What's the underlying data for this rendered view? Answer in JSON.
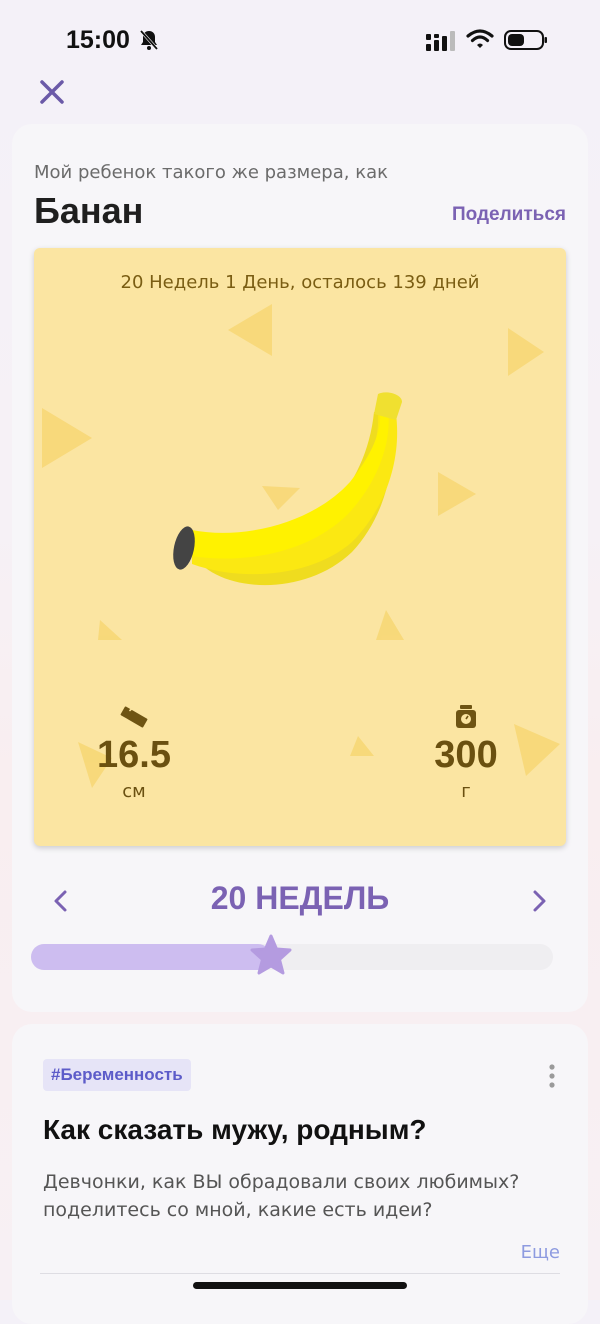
{
  "status_bar": {
    "time": "15:00",
    "icons": [
      "bell-slash-icon",
      "signal-icon",
      "wifi-icon",
      "battery-icon"
    ]
  },
  "nav": {
    "close_icon": "close-icon"
  },
  "size_card": {
    "subtitle": "Мой ребенок такого же размера, как",
    "fruit_name": "Банан",
    "share_label": "Поделиться",
    "week_info": "20 Недель 1 День, осталось 139 дней",
    "illustration": "banana",
    "length": {
      "icon": "ruler-icon",
      "value": "16.5",
      "unit": "см"
    },
    "weight": {
      "icon": "scale-icon",
      "value": "300",
      "unit": "г"
    }
  },
  "week_selector": {
    "label": "20 НЕДЕЛЬ",
    "prev_icon": "chevron-left-icon",
    "next_icon": "chevron-right-icon",
    "progress_fraction": 0.46
  },
  "post": {
    "tag": "#Беременность",
    "title": "Как сказать мужу, родным?",
    "body": "Девчонки, как ВЫ обрадовали своих любимых? поделитесь со мной, какие есть идеи?",
    "more_label": "Еще",
    "menu_icon": "more-vertical-icon"
  },
  "colors": {
    "accent": "#7b62b3",
    "card_yellow": "#fbe5a2",
    "slider_fill": "#cdbdf0",
    "tag_bg": "#e6e4f7",
    "tag_text": "#5d5cc9",
    "link_light": "#8e9be0"
  }
}
